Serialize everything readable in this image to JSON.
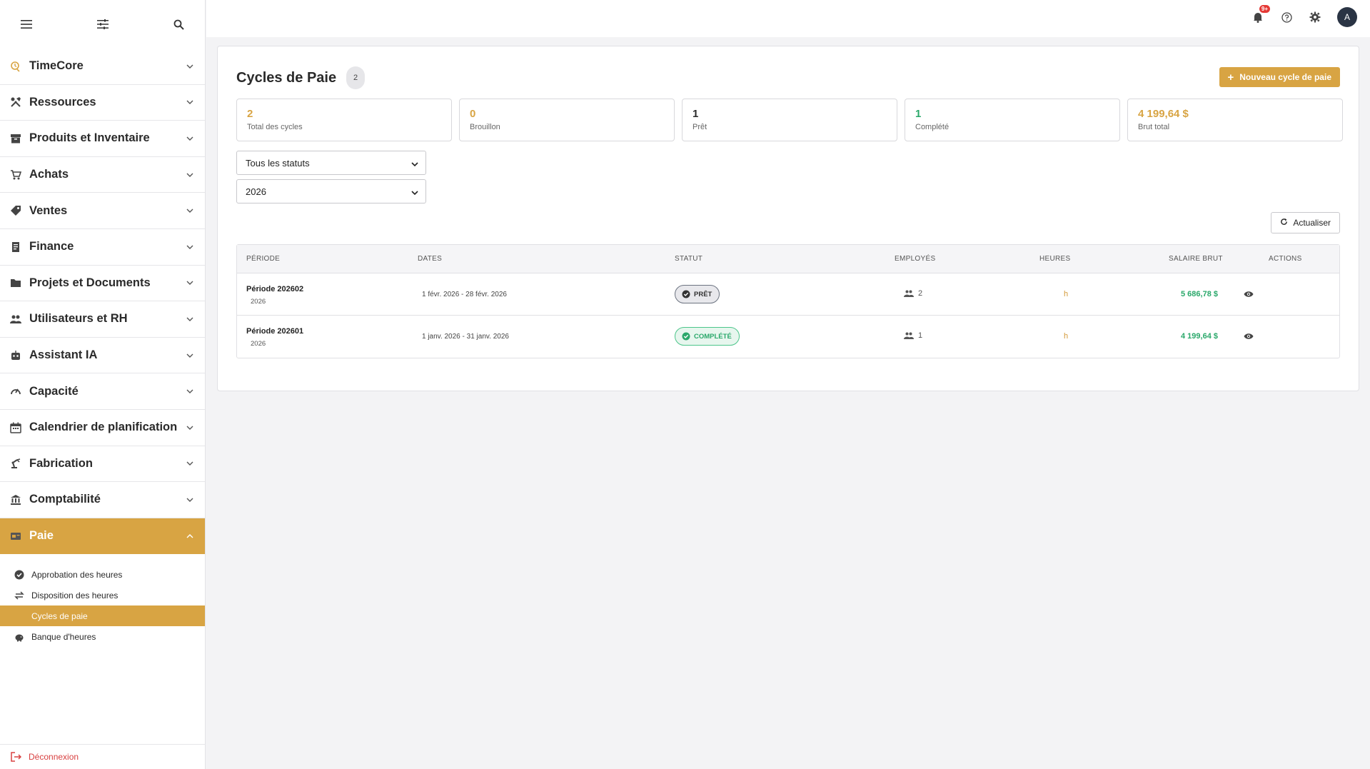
{
  "sidebar": {
    "items": [
      {
        "label": "TimeCore",
        "icon": "timecore-icon"
      },
      {
        "label": "Ressources",
        "icon": "tools-icon"
      },
      {
        "label": "Produits et Inventaire",
        "icon": "inventory-icon"
      },
      {
        "label": "Achats",
        "icon": "cart-icon"
      },
      {
        "label": "Ventes",
        "icon": "tag-icon"
      },
      {
        "label": "Finance",
        "icon": "receipt-icon"
      },
      {
        "label": "Projets et Documents",
        "icon": "folder-icon"
      },
      {
        "label": "Utilisateurs et RH",
        "icon": "people-icon"
      },
      {
        "label": "Assistant IA",
        "icon": "robot-icon"
      },
      {
        "label": "Capacité",
        "icon": "gauge-icon"
      },
      {
        "label": "Calendrier de planification",
        "icon": "calendar-icon"
      },
      {
        "label": "Fabrication",
        "icon": "robot-arm-icon"
      },
      {
        "label": "Comptabilité",
        "icon": "bank-icon"
      },
      {
        "label": "Paie",
        "icon": "payroll-icon"
      }
    ],
    "submenu": [
      {
        "label": "Approbation des heures",
        "icon": "check-circle-icon"
      },
      {
        "label": "Disposition des heures",
        "icon": "swap-icon"
      },
      {
        "label": "Cycles de paie",
        "icon": ""
      },
      {
        "label": "Banque d'heures",
        "icon": "piggy-bank-icon"
      }
    ],
    "logout_label": "Déconnexion"
  },
  "topbar": {
    "notification_count": "9+",
    "avatar_initial": "A"
  },
  "page": {
    "title": "Cycles de Paie",
    "count": "2",
    "new_button_label": "Nouveau cycle de paie",
    "refresh_label": "Actualiser"
  },
  "stats": [
    {
      "value": "2",
      "label": "Total des cycles",
      "color": "#d8a443"
    },
    {
      "value": "0",
      "label": "Brouillon",
      "color": "#d8a443"
    },
    {
      "value": "1",
      "label": "Prêt",
      "color": "#2a2a2a"
    },
    {
      "value": "1",
      "label": "Complété",
      "color": "#2aa86a"
    },
    {
      "value": "4 199,64 $",
      "label": "Brut total",
      "color": "#d8a443"
    }
  ],
  "filters": {
    "status_selected": "Tous les statuts",
    "year_selected": "2026"
  },
  "table": {
    "headers": {
      "period": "PÉRIODE",
      "dates": "DATES",
      "status": "STATUT",
      "employees": "EMPLOYÉS",
      "hours": "HEURES",
      "salary": "SALAIRE BRUT",
      "actions": "ACTIONS"
    },
    "rows": [
      {
        "period": "Période 202602",
        "year": "2026",
        "dates": "1 févr. 2026 - 28 févr. 2026",
        "status": "PRÊT",
        "status_kind": "ready",
        "employees": "2",
        "hours": "h",
        "salary": "5 686,78 $"
      },
      {
        "period": "Période 202601",
        "year": "2026",
        "dates": "1 janv. 2026 - 31 janv. 2026",
        "status": "COMPLÉTÉ",
        "status_kind": "done",
        "employees": "1",
        "hours": "h",
        "salary": "4 199,64 $"
      }
    ]
  },
  "colors": {
    "accent": "#d8a443",
    "success": "#2aa86a",
    "danger": "#d84040"
  }
}
